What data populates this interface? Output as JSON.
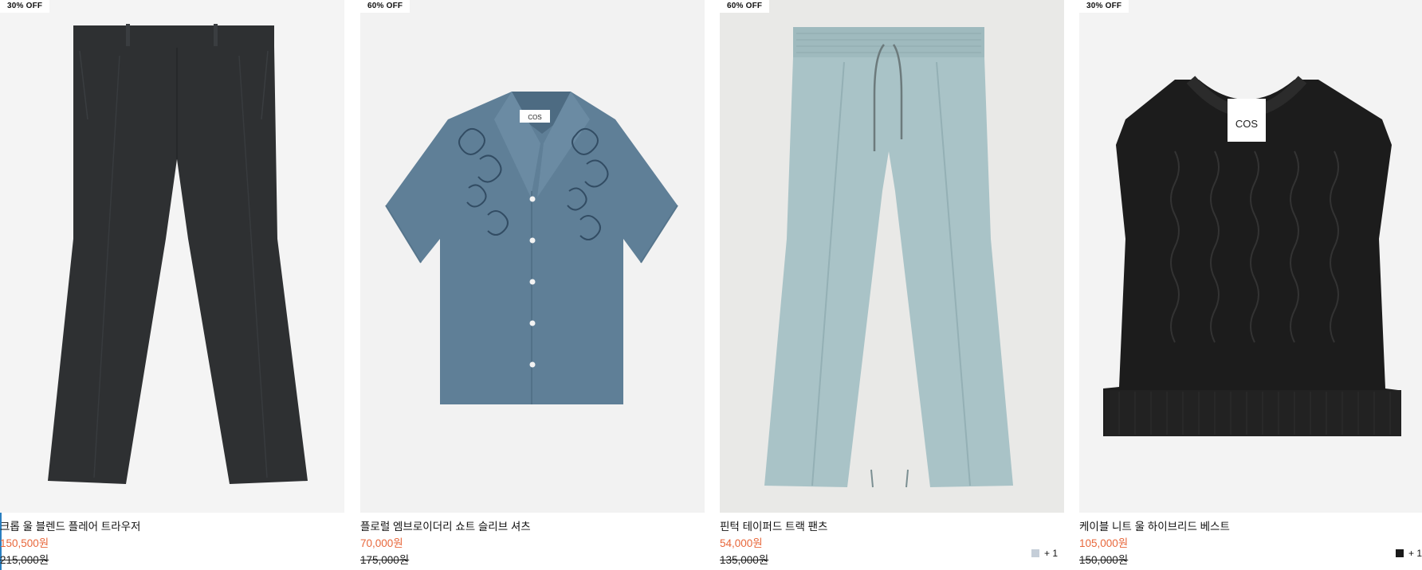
{
  "products": [
    {
      "badge": "30% OFF",
      "name": "크롭 울 블렌드 플레어 트라우저",
      "sale_price": "150,500원",
      "original_price": "215,000원",
      "image_bg": "#f4f4f4",
      "garment_color": "#2e3032",
      "image_icon": "flare-trousers-image"
    },
    {
      "badge": "60% OFF",
      "name": "플로럴 엠브로이더리 쇼트 슬리브 셔츠",
      "sale_price": "70,000원",
      "original_price": "175,000원",
      "image_bg": "#f2f2f2",
      "garment_color": "#5f7f97",
      "image_icon": "short-sleeve-shirt-image",
      "label_text": "COS"
    },
    {
      "badge": "60% OFF",
      "name": "핀턱 테이퍼드 트랙 팬츠",
      "sale_price": "54,000원",
      "original_price": "135,000원",
      "image_bg": "#e9e9e7",
      "garment_color": "#a9c3c7",
      "image_icon": "track-pants-image",
      "swatch_color": "#c5ced8",
      "swatch_more": "+ 1"
    },
    {
      "badge": "30% OFF",
      "name": "케이블 니트 울 하이브리드 베스트",
      "sale_price": "105,000원",
      "original_price": "150,000원",
      "image_bg": "#f3f3f3",
      "garment_color": "#1c1c1c",
      "image_icon": "knit-vest-image",
      "label_text": "COS",
      "swatch_color": "#1a1a1a",
      "swatch_more": "+ 1"
    }
  ],
  "colors": {
    "sale_price": "#e8673b",
    "accent_rule": "#2a7fc0"
  }
}
